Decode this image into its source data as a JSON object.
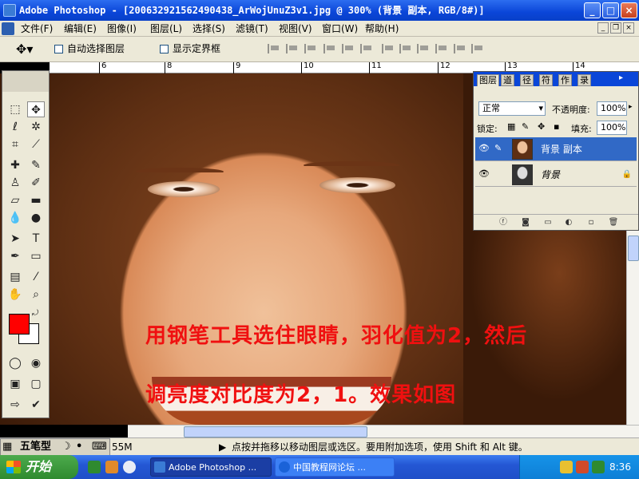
{
  "window": {
    "title": "Adobe Photoshop - [200632921562490438_ArWojUnuZ3v1.jpg @ 300% (背景 副本, RGB/8#)]",
    "minimize": "_",
    "maximize": "□",
    "close": "×"
  },
  "menu": {
    "items": [
      "文件(F)",
      "编辑(E)",
      "图像(I)",
      "图层(L)",
      "选择(S)",
      "滤镜(T)",
      "视图(V)",
      "窗口(W)",
      "帮助(H)"
    ],
    "doc_minimize": "_",
    "doc_restore": "❐",
    "doc_close": "×"
  },
  "options": {
    "auto_select_layer": "自动选择图层",
    "show_bounding_box": "显示定界框"
  },
  "ruler": {
    "ticks": [
      "6",
      "8",
      "9",
      "10",
      "11",
      "12",
      "13",
      "14"
    ]
  },
  "canvas": {
    "caption_line1": "用钢笔工具选住眼睛，羽化值为2，然后",
    "caption_line2": "调亮度对比度为2，1。效果如图"
  },
  "toolbox": {
    "colors": {
      "foreground": "#ff0000",
      "background": "#ffffff"
    }
  },
  "layers_palette": {
    "tabs": [
      "图层",
      "道",
      "径",
      "符",
      "作",
      "录"
    ],
    "blend_mode": "正常",
    "opacity_label": "不透明度:",
    "opacity_value": "100%",
    "lock_label": "锁定:",
    "fill_label": "填充:",
    "fill_value": "100%",
    "layers": [
      {
        "name": "背景 副本",
        "active": true
      },
      {
        "name": "背景",
        "active": false,
        "locked": true
      }
    ]
  },
  "status": {
    "ime": "五笔型",
    "doc_size": "55M",
    "hint": "点按并拖移以移动图层或选区。要用附加选项，使用 Shift 和 Alt 键。"
  },
  "taskbar": {
    "start": "开始",
    "tasks": [
      "Adobe Photoshop ...",
      "中国教程网论坛 ..."
    ],
    "time": "8:36",
    "ime_tray": "五"
  }
}
